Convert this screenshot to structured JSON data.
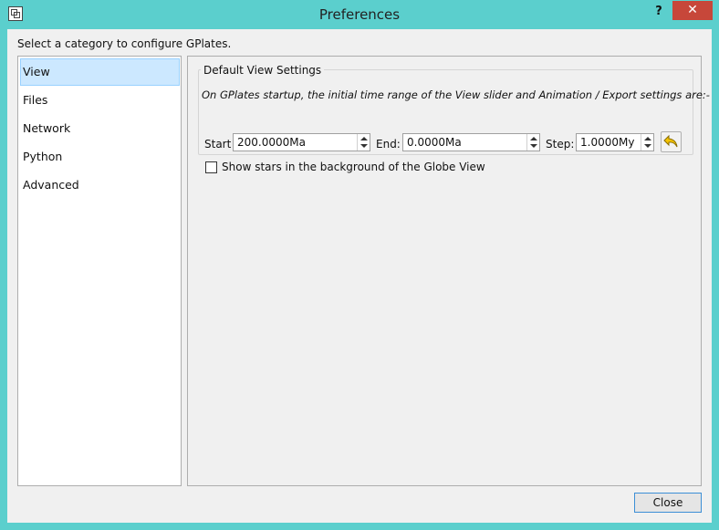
{
  "window": {
    "title": "Preferences",
    "help_label": "?",
    "close_label": "✕"
  },
  "instruction": "Select a category to configure GPlates.",
  "categories": [
    {
      "label": "View",
      "selected": true
    },
    {
      "label": "Files",
      "selected": false
    },
    {
      "label": "Network",
      "selected": false
    },
    {
      "label": "Python",
      "selected": false
    },
    {
      "label": "Advanced",
      "selected": false
    }
  ],
  "view_page": {
    "group_title": "Default View Settings",
    "startup_text": "On GPlates startup, the initial time range of the View slider and Animation / Export settings are:-",
    "start_label": "Start",
    "start_value": "200.0000Ma",
    "end_label": "End:",
    "end_value": "0.0000Ma",
    "step_label": "Step:",
    "step_value": "1.0000My",
    "show_stars_label": "Show stars in the background of the Globe View",
    "show_stars_checked": false
  },
  "footer": {
    "close_button": "Close"
  },
  "colors": {
    "frame": "#5bcfcd",
    "selection": "#cce8ff",
    "close_caption": "#c7473a"
  }
}
